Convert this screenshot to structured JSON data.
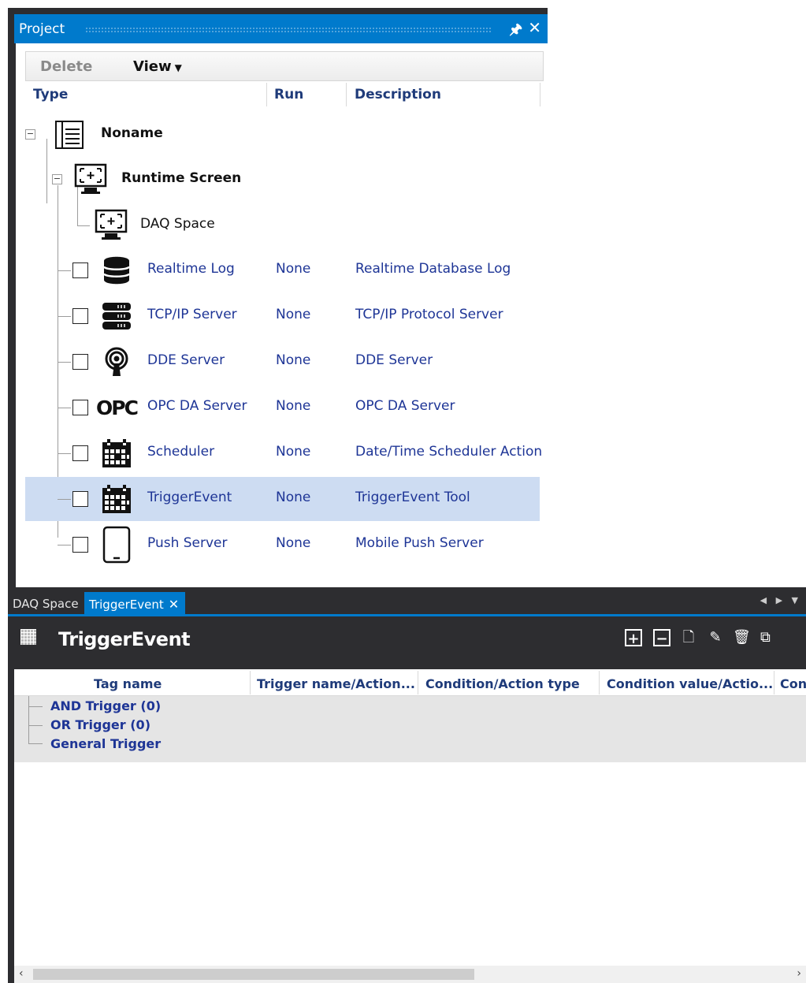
{
  "project_panel": {
    "title": "Project",
    "pin_glyph": "Ȩ",
    "toolbar": {
      "delete_label": "Delete",
      "view_label": "View"
    },
    "columns": {
      "type": "Type",
      "run": "Run",
      "description": "Description"
    },
    "root": {
      "name": "Noname",
      "icon": "document-list-icon"
    },
    "runtime": {
      "name": "Runtime Screen",
      "icon": "monitor-icon"
    },
    "daq": {
      "name": "DAQ Space",
      "icon": "monitor-icon"
    },
    "items": [
      {
        "name": "Realtime Log",
        "run": "None",
        "description": "Realtime Database Log",
        "icon": "database-icon"
      },
      {
        "name": "TCP/IP Server",
        "run": "None",
        "description": "TCP/IP Protocol Server",
        "icon": "server-rack-icon"
      },
      {
        "name": "DDE Server",
        "run": "None",
        "description": "DDE Server",
        "icon": "broadcast-icon"
      },
      {
        "name": "OPC DA Server",
        "run": "None",
        "description": "OPC DA Server",
        "icon": "opc-logo-icon",
        "icon_text": "OPC"
      },
      {
        "name": "Scheduler",
        "run": "None",
        "description": "Date/Time Scheduler Action",
        "icon": "calendar-icon"
      },
      {
        "name": "TriggerEvent",
        "run": "None",
        "description": "TriggerEvent Tool",
        "icon": "calendar-icon",
        "selected": true
      },
      {
        "name": "Push Server",
        "run": "None",
        "description": "Mobile Push Server",
        "icon": "tablet-icon"
      }
    ]
  },
  "tabs": {
    "daq_label": "DAQ Space",
    "trigger_label": "TriggerEvent"
  },
  "trigger": {
    "title": "TriggerEvent",
    "columns": [
      "Tag name",
      "Trigger name/Action...",
      "Condition/Action type",
      "Condition value/Actio...",
      "Con"
    ],
    "rows": [
      "AND Trigger (0)",
      "OR Trigger (0)",
      "General Trigger"
    ]
  },
  "colors": {
    "accent": "#007acc",
    "dark": "#2d2d30",
    "selected_row": "#cddcf2",
    "link_text": "#1e3596"
  }
}
